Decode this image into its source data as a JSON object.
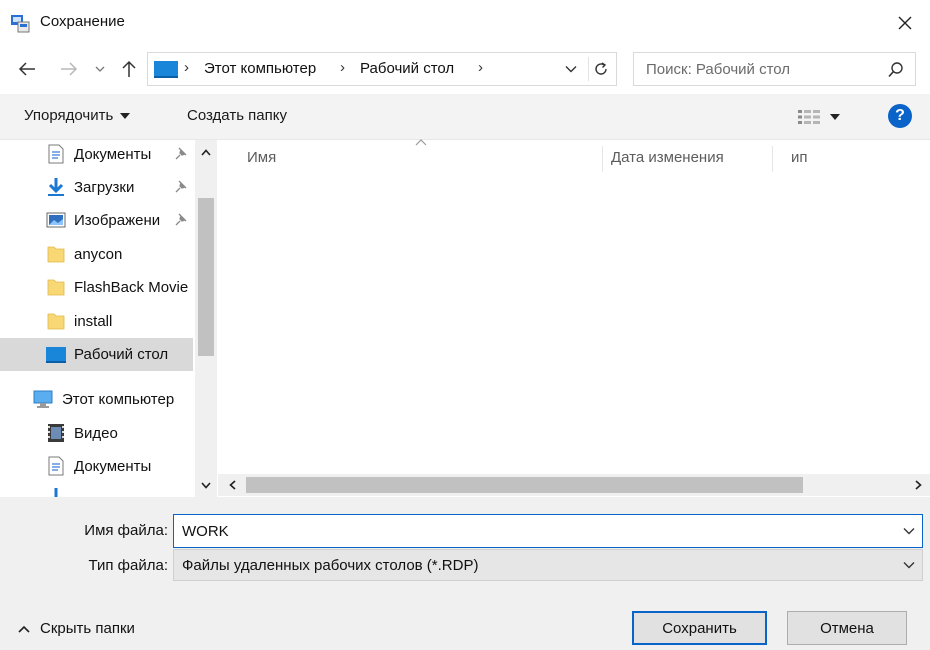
{
  "window": {
    "title": "Сохранение",
    "app_icon": "save-dialog-icon",
    "close_icon": "close-icon"
  },
  "navigation": {
    "back_icon": "arrow-left-icon",
    "forward_icon": "arrow-right-icon",
    "recent_icon": "chevron-down-icon",
    "up_icon": "arrow-up-icon"
  },
  "address_bar": {
    "breadcrumbs": [
      "Этот компьютер",
      "Рабочий стол"
    ],
    "refresh_icon": "refresh-icon"
  },
  "search": {
    "placeholder": "Поиск: Рабочий стол"
  },
  "toolbar": {
    "organize_label": "Упорядочить",
    "new_folder_label": "Создать папку",
    "help_label": "?"
  },
  "nav_pane": {
    "items": [
      {
        "label": "Документы",
        "icon": "documents-icon",
        "pinned": true
      },
      {
        "label": "Загрузки",
        "icon": "download-icon",
        "pinned": true
      },
      {
        "label": "Изображени",
        "icon": "pictures-icon",
        "pinned": true
      },
      {
        "label": "anycon",
        "icon": "folder-icon",
        "pinned": false
      },
      {
        "label": "FlashBack Movie",
        "icon": "folder-icon",
        "pinned": false
      },
      {
        "label": "install",
        "icon": "folder-icon",
        "pinned": false
      },
      {
        "label": "Рабочий стол",
        "icon": "desktop-icon",
        "pinned": false,
        "selected": true
      },
      {
        "label": "Этот компьютер",
        "icon": "computer-icon",
        "pinned": false
      },
      {
        "label": "Видео",
        "icon": "video-icon",
        "pinned": false
      },
      {
        "label": "Документы",
        "icon": "documents-icon",
        "pinned": false
      }
    ]
  },
  "file_list": {
    "columns": [
      "Имя",
      "Дата изменения",
      "Тип"
    ],
    "col3_visible": "ип"
  },
  "form": {
    "filename_label": "Имя файла:",
    "filename_value": "WORK",
    "filetype_label": "Тип файла:",
    "filetype_value": "Файлы удаленных рабочих столов (*.RDP)"
  },
  "footer": {
    "hide_folders_label": "Скрыть папки",
    "save_label": "Сохранить",
    "cancel_label": "Отмена"
  },
  "colors": {
    "accent": "#0a63c9",
    "selected_bg": "#d9d9d9",
    "toolbar_bg": "#f3f3f3",
    "bottom_bg": "#f0f0f0",
    "folder_yellow": "#f8d775"
  }
}
